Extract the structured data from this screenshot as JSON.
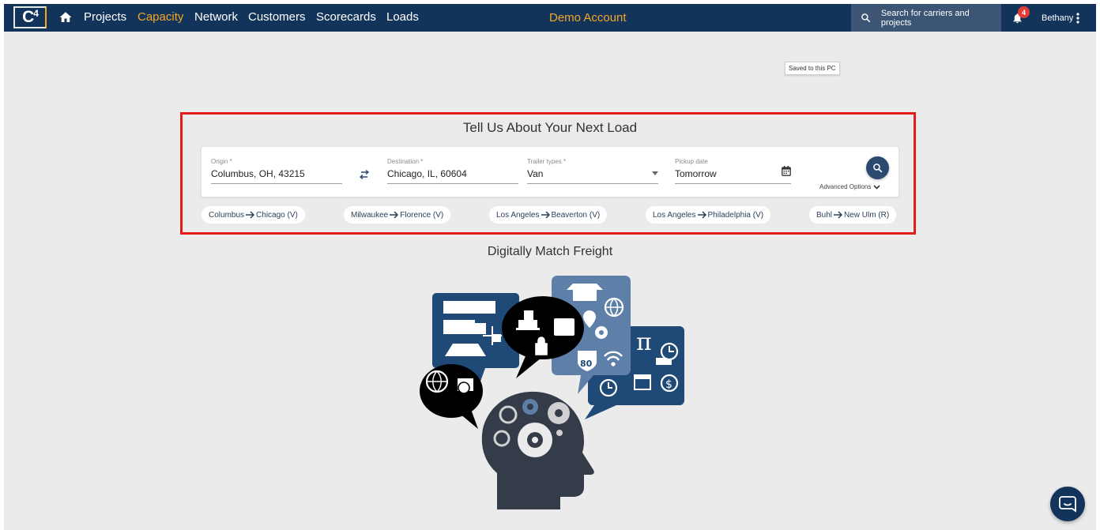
{
  "nav": {
    "logo": "C",
    "logo_sup": "4",
    "items": [
      {
        "label": "Projects"
      },
      {
        "label": "Capacity"
      },
      {
        "label": "Network"
      },
      {
        "label": "Customers"
      },
      {
        "label": "Scorecards"
      },
      {
        "label": "Loads"
      }
    ],
    "active": "Capacity",
    "account": "Demo Account",
    "search_placeholder": "Search for carriers and projects",
    "notification_count": "4",
    "user": "Bethany"
  },
  "tooltip": "Saved to this PC",
  "load_form": {
    "title": "Tell Us About Your Next Load",
    "origin": {
      "label": "Origin *",
      "value": "Columbus, OH, 43215"
    },
    "destination": {
      "label": "Destination *",
      "value": "Chicago, IL, 60604"
    },
    "trailer": {
      "label": "Trailer types *",
      "value": "Van"
    },
    "pickup": {
      "label": "Pickup date",
      "value": "Tomorrow"
    },
    "advanced_label": "Advanced Options"
  },
  "recent_searches": [
    {
      "from": "Columbus",
      "to": "Chicago (V)"
    },
    {
      "from": "Milwaukee",
      "to": "Florence (V)"
    },
    {
      "from": "Los Angeles",
      "to": "Beaverton (V)"
    },
    {
      "from": "Los Angeles",
      "to": "Philadelphia (V)"
    },
    {
      "from": "Buhl",
      "to": "New Ulm (R)"
    }
  ],
  "illustration": {
    "title": "Digitally Match Freight",
    "highway_shield": "80",
    "pi_symbol": "π"
  },
  "colors": {
    "navbar": "#13345a",
    "accent": "#f5a623",
    "highlight_border": "#e51b1b",
    "badge": "#e53935"
  }
}
